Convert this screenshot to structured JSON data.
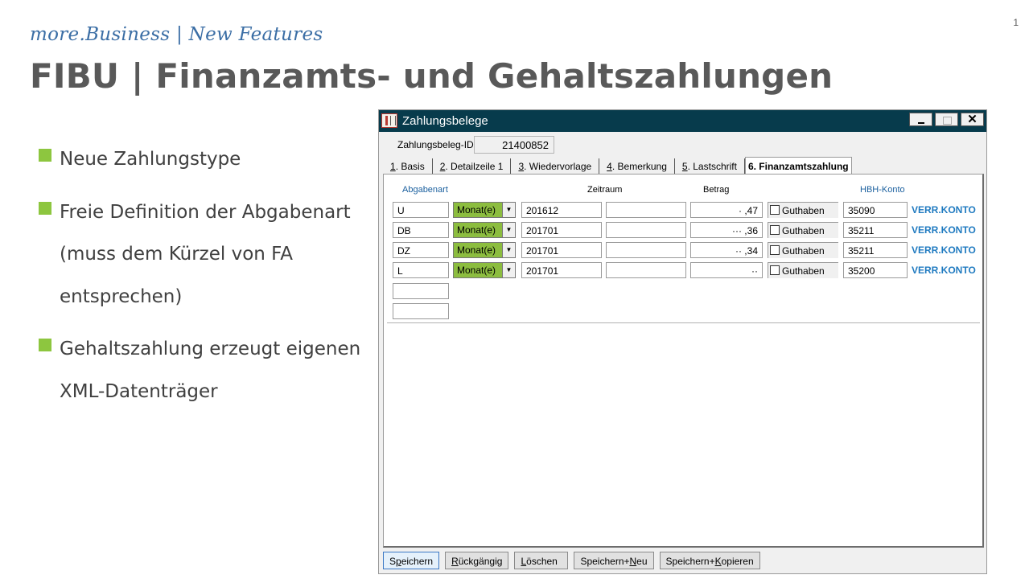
{
  "slide": {
    "page_number": "1",
    "subtitle": "more.Business | New Features",
    "title": "FIBU | Finanzamts- und Gehaltszahlungen",
    "bullets": [
      "Neue Zahlungstype",
      "Freie Definition der Abgabenart (muss dem Kürzel von FA entsprechen)",
      "Gehaltszahlung erzeugt eigenen XML-Datenträger"
    ],
    "bullet_color": "#8dc63f"
  },
  "window": {
    "title": "Zahlungsbelege",
    "controls": {
      "minimize": "_",
      "close": "✕"
    },
    "id_label": "Zahlungsbeleg-ID:",
    "id_value": "21400852",
    "tabs": [
      {
        "num": "1",
        "label": ". Basis"
      },
      {
        "num": "2",
        "label": ". Detailzeile 1"
      },
      {
        "num": "3",
        "label": ". Wiedervorlage"
      },
      {
        "num": "4",
        "label": ". Bemerkung"
      },
      {
        "num": "5",
        "label": ". Lastschrift"
      },
      {
        "num": "",
        "label": "6. Finanzamtszahlung"
      }
    ],
    "active_tab": 5,
    "headers": {
      "abgabenart": "Abgabenart",
      "zeitraum": "Zeitraum",
      "betrag": "Betrag",
      "hbh_konto": "HBH-Konto"
    },
    "rows": [
      {
        "abgabenart": "U",
        "period_type": "Monat(e)",
        "von": "201612",
        "bis": "",
        "betrag": "·  ,47",
        "guthaben": "Guthaben",
        "konto": "35090",
        "konto_label": "VERR.KONTO"
      },
      {
        "abgabenart": "DB",
        "period_type": "Monat(e)",
        "von": "201701",
        "bis": "",
        "betrag": "··· ,36",
        "guthaben": "Guthaben",
        "konto": "35211",
        "konto_label": "VERR.KONTO"
      },
      {
        "abgabenart": "DZ",
        "period_type": "Monat(e)",
        "von": "201701",
        "bis": "",
        "betrag": "·· ,34",
        "guthaben": "Guthaben",
        "konto": "35211",
        "konto_label": "VERR.KONTO"
      },
      {
        "abgabenart": "L",
        "period_type": "Monat(e)",
        "von": "201701",
        "bis": "",
        "betrag": "··",
        "guthaben": "Guthaben",
        "konto": "35200",
        "konto_label": "VERR.KONTO"
      }
    ],
    "empty_rows": [
      "",
      ""
    ],
    "buttons": [
      {
        "pre": "S",
        "key": "p",
        "post": "eichern"
      },
      {
        "pre": "",
        "key": "R",
        "post": "ückgängig"
      },
      {
        "pre": "",
        "key": "L",
        "post": "öschen"
      },
      {
        "pre": "Speichern+",
        "key": "N",
        "post": "eu"
      },
      {
        "pre": "Speichern+",
        "key": "K",
        "post": "opieren"
      }
    ],
    "colors": {
      "titlebar": "#073b4c",
      "combo_highlight": "#8cbd3f",
      "konto_link": "#1f7ac0",
      "header_blue": "#1a5f9e"
    }
  }
}
